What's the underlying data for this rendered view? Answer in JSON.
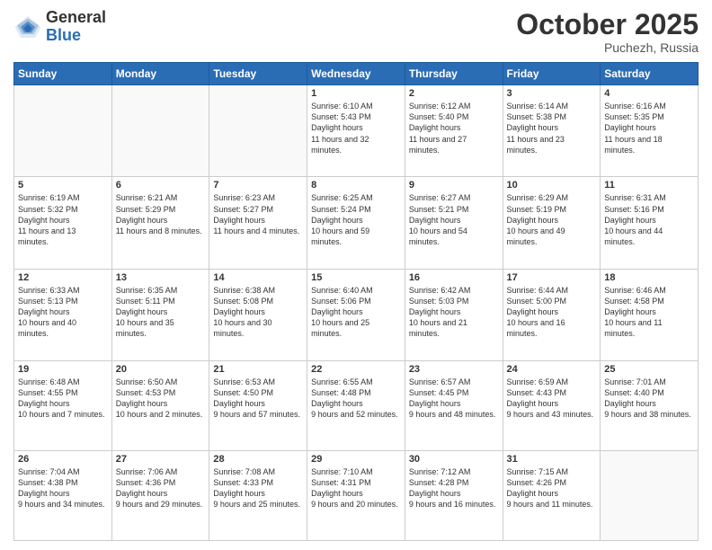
{
  "logo": {
    "general": "General",
    "blue": "Blue"
  },
  "title": "October 2025",
  "location": "Puchezh, Russia",
  "days_of_week": [
    "Sunday",
    "Monday",
    "Tuesday",
    "Wednesday",
    "Thursday",
    "Friday",
    "Saturday"
  ],
  "weeks": [
    [
      {
        "day": "",
        "empty": true
      },
      {
        "day": "",
        "empty": true
      },
      {
        "day": "",
        "empty": true
      },
      {
        "day": "1",
        "sunrise": "6:10 AM",
        "sunset": "5:43 PM",
        "daylight": "11 hours and 32 minutes."
      },
      {
        "day": "2",
        "sunrise": "6:12 AM",
        "sunset": "5:40 PM",
        "daylight": "11 hours and 27 minutes."
      },
      {
        "day": "3",
        "sunrise": "6:14 AM",
        "sunset": "5:38 PM",
        "daylight": "11 hours and 23 minutes."
      },
      {
        "day": "4",
        "sunrise": "6:16 AM",
        "sunset": "5:35 PM",
        "daylight": "11 hours and 18 minutes."
      }
    ],
    [
      {
        "day": "5",
        "sunrise": "6:19 AM",
        "sunset": "5:32 PM",
        "daylight": "11 hours and 13 minutes."
      },
      {
        "day": "6",
        "sunrise": "6:21 AM",
        "sunset": "5:29 PM",
        "daylight": "11 hours and 8 minutes."
      },
      {
        "day": "7",
        "sunrise": "6:23 AM",
        "sunset": "5:27 PM",
        "daylight": "11 hours and 4 minutes."
      },
      {
        "day": "8",
        "sunrise": "6:25 AM",
        "sunset": "5:24 PM",
        "daylight": "10 hours and 59 minutes."
      },
      {
        "day": "9",
        "sunrise": "6:27 AM",
        "sunset": "5:21 PM",
        "daylight": "10 hours and 54 minutes."
      },
      {
        "day": "10",
        "sunrise": "6:29 AM",
        "sunset": "5:19 PM",
        "daylight": "10 hours and 49 minutes."
      },
      {
        "day": "11",
        "sunrise": "6:31 AM",
        "sunset": "5:16 PM",
        "daylight": "10 hours and 44 minutes."
      }
    ],
    [
      {
        "day": "12",
        "sunrise": "6:33 AM",
        "sunset": "5:13 PM",
        "daylight": "10 hours and 40 minutes."
      },
      {
        "day": "13",
        "sunrise": "6:35 AM",
        "sunset": "5:11 PM",
        "daylight": "10 hours and 35 minutes."
      },
      {
        "day": "14",
        "sunrise": "6:38 AM",
        "sunset": "5:08 PM",
        "daylight": "10 hours and 30 minutes."
      },
      {
        "day": "15",
        "sunrise": "6:40 AM",
        "sunset": "5:06 PM",
        "daylight": "10 hours and 25 minutes."
      },
      {
        "day": "16",
        "sunrise": "6:42 AM",
        "sunset": "5:03 PM",
        "daylight": "10 hours and 21 minutes."
      },
      {
        "day": "17",
        "sunrise": "6:44 AM",
        "sunset": "5:00 PM",
        "daylight": "10 hours and 16 minutes."
      },
      {
        "day": "18",
        "sunrise": "6:46 AM",
        "sunset": "4:58 PM",
        "daylight": "10 hours and 11 minutes."
      }
    ],
    [
      {
        "day": "19",
        "sunrise": "6:48 AM",
        "sunset": "4:55 PM",
        "daylight": "10 hours and 7 minutes."
      },
      {
        "day": "20",
        "sunrise": "6:50 AM",
        "sunset": "4:53 PM",
        "daylight": "10 hours and 2 minutes."
      },
      {
        "day": "21",
        "sunrise": "6:53 AM",
        "sunset": "4:50 PM",
        "daylight": "9 hours and 57 minutes."
      },
      {
        "day": "22",
        "sunrise": "6:55 AM",
        "sunset": "4:48 PM",
        "daylight": "9 hours and 52 minutes."
      },
      {
        "day": "23",
        "sunrise": "6:57 AM",
        "sunset": "4:45 PM",
        "daylight": "9 hours and 48 minutes."
      },
      {
        "day": "24",
        "sunrise": "6:59 AM",
        "sunset": "4:43 PM",
        "daylight": "9 hours and 43 minutes."
      },
      {
        "day": "25",
        "sunrise": "7:01 AM",
        "sunset": "4:40 PM",
        "daylight": "9 hours and 38 minutes."
      }
    ],
    [
      {
        "day": "26",
        "sunrise": "7:04 AM",
        "sunset": "4:38 PM",
        "daylight": "9 hours and 34 minutes."
      },
      {
        "day": "27",
        "sunrise": "7:06 AM",
        "sunset": "4:36 PM",
        "daylight": "9 hours and 29 minutes."
      },
      {
        "day": "28",
        "sunrise": "7:08 AM",
        "sunset": "4:33 PM",
        "daylight": "9 hours and 25 minutes."
      },
      {
        "day": "29",
        "sunrise": "7:10 AM",
        "sunset": "4:31 PM",
        "daylight": "9 hours and 20 minutes."
      },
      {
        "day": "30",
        "sunrise": "7:12 AM",
        "sunset": "4:28 PM",
        "daylight": "9 hours and 16 minutes."
      },
      {
        "day": "31",
        "sunrise": "7:15 AM",
        "sunset": "4:26 PM",
        "daylight": "9 hours and 11 minutes."
      },
      {
        "day": "",
        "empty": true
      }
    ]
  ],
  "labels": {
    "sunrise": "Sunrise:",
    "sunset": "Sunset:",
    "daylight": "Daylight hours"
  }
}
